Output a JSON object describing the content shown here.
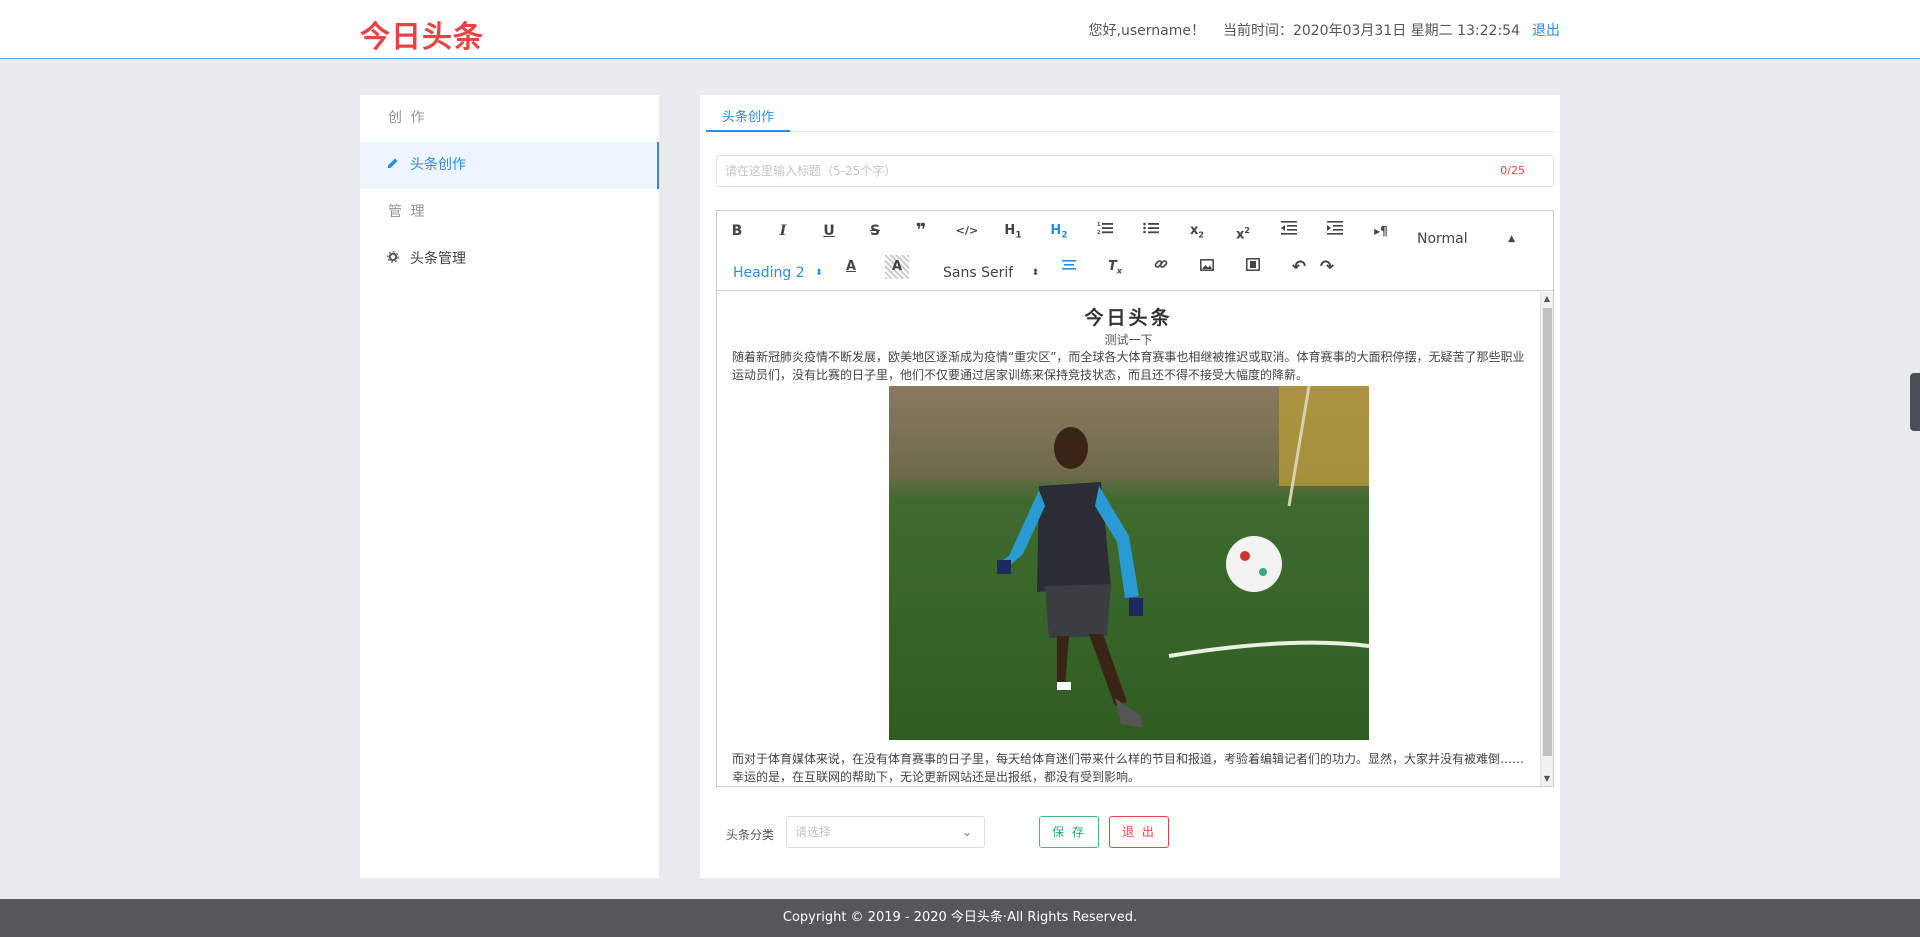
{
  "header": {
    "logo": "今日头条",
    "greeting": "您好,username！",
    "time_label": "当前时间：",
    "time_value": "2020年03月31日 星期二 13:22:54",
    "logout": "退出"
  },
  "sidebar": {
    "sections": [
      {
        "title": "创 作",
        "items": [
          {
            "label": "头条创作",
            "icon": "pencil-icon",
            "active": true
          }
        ]
      },
      {
        "title": "管 理",
        "items": [
          {
            "label": "头条管理",
            "icon": "gear-icon",
            "active": false
          }
        ]
      }
    ]
  },
  "main": {
    "tab": "头条创作",
    "title_placeholder": "请在这里输入标题（5-25个字）",
    "title_value": "",
    "counter": "0/25",
    "toolbar": {
      "header_select": "Normal",
      "heading_select": "Heading 2",
      "font_select": "Sans Serif"
    },
    "content": {
      "title": "今日头条",
      "subtitle": "测试一下",
      "para1": "随着新冠肺炎疫情不断发展，欧美地区逐渐成为疫情“重灾区”，而全球各大体育赛事也相继被推迟或取消。体育赛事的大面积停摆，无疑苦了那些职业运动员们，没有比赛的日子里，他们不仅要通过居家训练来保持竞技状态，而且还不得不接受大幅度的降薪。",
      "para2": "而对于体育媒体来说，在没有体育赛事的日子里，每天给体育迷们带来什么样的节目和报道，考验着编辑记者们的功力。显然，大家并没有被难倒……",
      "para3": "幸运的是，在互联网的帮助下，无论更新网站还是出报纸，都没有受到影响。"
    },
    "category_label": "头条分类",
    "category_placeholder": "请选择",
    "save": "保 存",
    "exit": "退 出"
  },
  "footer": {
    "copyright": "Copyright © 2019 - 2020 今日头条·All Rights Reserved."
  },
  "colors": {
    "brand": "#e64545",
    "accent": "#2b8ce6",
    "save": "#42b983",
    "footer_bg": "#54585c"
  }
}
